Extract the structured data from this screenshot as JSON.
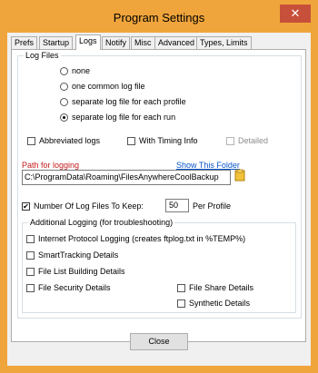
{
  "window": {
    "title": "Program Settings",
    "close_glyph": "✕"
  },
  "tabs": [
    {
      "label": "Prefs"
    },
    {
      "label": "Startup"
    },
    {
      "label": "Logs"
    },
    {
      "label": "Notify"
    },
    {
      "label": "Misc"
    },
    {
      "label": "Advanced"
    },
    {
      "label": "Types, Limits"
    }
  ],
  "active_tab": "Logs",
  "log_files": {
    "legend": "Log Files",
    "options": [
      {
        "label": "none",
        "selected": false
      },
      {
        "label": "one common log file",
        "selected": false
      },
      {
        "label": "separate log file for each profile",
        "selected": false
      },
      {
        "label": "separate log file for each run",
        "selected": true
      }
    ],
    "abbreviated": {
      "label": "Abbreviated logs",
      "checked": false
    },
    "timing": {
      "label": "With Timing Info",
      "checked": false
    },
    "detailed": {
      "label": "Detailed",
      "checked": false,
      "disabled": true
    },
    "path_label": "Path for logging",
    "show_folder": "Show This Folder",
    "path_value": "C:\\ProgramData\\Roaming\\FilesAnywhereCoolBackup",
    "keep_label": "Number Of Log Files To Keep:",
    "keep_checked": true,
    "keep_value": "50",
    "per_profile": "Per Profile"
  },
  "additional": {
    "legend": "Additional Logging (for troubleshooting)",
    "items": [
      {
        "label": "Internet Protocol Logging (creates ftplog.txt in %TEMP%)",
        "checked": false
      },
      {
        "label": "SmartTracking Details",
        "checked": false
      },
      {
        "label": "File List Building Details",
        "checked": false
      },
      {
        "label": "File Security Details",
        "checked": false
      },
      {
        "label": "File Share Details",
        "checked": false
      },
      {
        "label": "Synthetic Details",
        "checked": false
      }
    ]
  },
  "footer": {
    "close_label": "Close"
  },
  "colors": {
    "titlebar": "#f0a53c",
    "close_button": "#c7503a",
    "link": "#0a56c8",
    "path_label": "#c41a1a"
  }
}
